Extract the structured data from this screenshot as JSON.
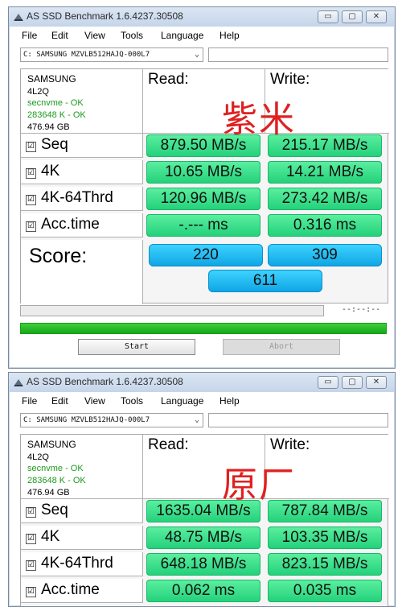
{
  "window_title": "AS SSD Benchmark 1.6.4237.30508",
  "controls": {
    "minimize": "▭",
    "maximize": "▢",
    "close": "✕"
  },
  "menu": [
    "File",
    "Edit",
    "View",
    "Tools",
    "Language",
    "Help"
  ],
  "drive": "C: SAMSUNG MZVLB512HAJQ-000L7",
  "info": {
    "model": "SAMSUNG",
    "firmware": "4L2Q",
    "driver": "secnvme - OK",
    "alignment": "283648 K - OK",
    "size": "476.94 GB"
  },
  "headers": {
    "read": "Read:",
    "write": "Write:"
  },
  "checkmark": "☑",
  "tests": [
    "Seq",
    "4K",
    "4K-64Thrd",
    "Acc.time"
  ],
  "score_label": "Score:",
  "time": "--:--:--",
  "buttons": {
    "start": "Start",
    "abort": "Abort"
  },
  "colors": {
    "result_green": "#22d07a",
    "score_blue": "#0ea4e4",
    "overlay_red": "#e02020",
    "ok_green": "#1e9a1e"
  },
  "panels": [
    {
      "overlay": "紫米",
      "read": [
        "879.50 MB/s",
        "10.65 MB/s",
        "120.96 MB/s",
        "-.--- ms"
      ],
      "write": [
        "215.17 MB/s",
        "14.21 MB/s",
        "273.42 MB/s",
        "0.316 ms"
      ],
      "score_read": "220",
      "score_write": "309",
      "score_total": "611",
      "progress": 1.0
    },
    {
      "overlay": "原厂",
      "read": [
        "1635.04 MB/s",
        "48.75 MB/s",
        "648.18 MB/s",
        "0.062 ms"
      ],
      "write": [
        "787.84 MB/s",
        "103.35 MB/s",
        "823.15 MB/s",
        "0.035 ms"
      ]
    }
  ]
}
